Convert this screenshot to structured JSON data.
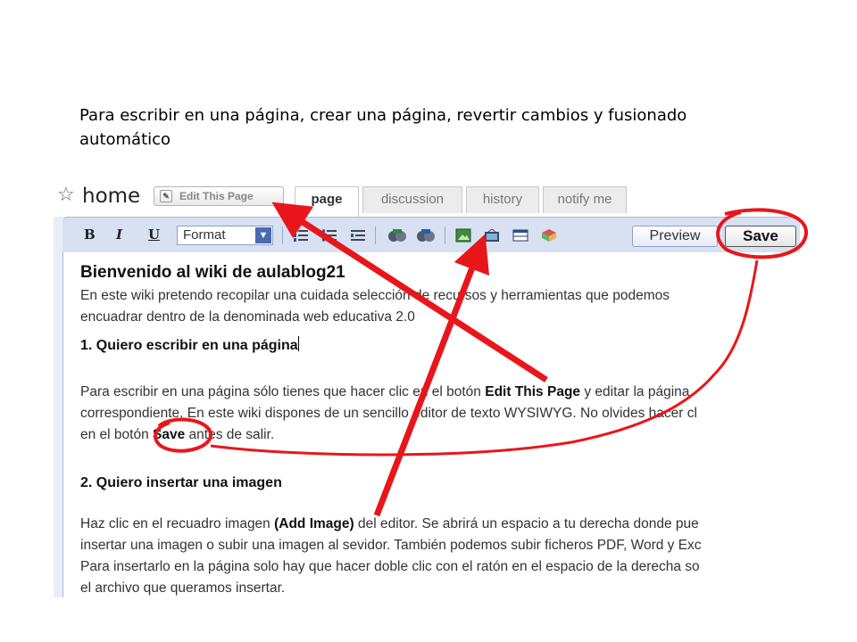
{
  "slide": {
    "caption": "Para escribir en una página, crear una página,  revertir cambios  y fusionado automático"
  },
  "wiki": {
    "page_name": "home",
    "edit_button": "Edit This Page",
    "tabs": [
      {
        "label": "page",
        "active": true
      },
      {
        "label": "discussion",
        "active": false
      },
      {
        "label": "history",
        "active": false
      },
      {
        "label": "notify me",
        "active": false
      }
    ],
    "toolbar": {
      "bold": "B",
      "italic": "I",
      "underline": "U",
      "format_value": "Format",
      "icons": [
        "numbered-list-icon",
        "bullet-list-icon",
        "indent-icon",
        "link-icon",
        "external-link-icon",
        "image-icon",
        "video-icon",
        "table-icon",
        "widget-icon"
      ],
      "preview": "Preview",
      "save": "Save"
    },
    "content": {
      "title": "Bienvenido al wiki de aulablog21",
      "intro_line1": "En este wiki pretendo recopilar una cuidada selección de recursos y herramientas que podemos",
      "intro_line2": "encuadrar dentro de la denominada web educativa 2.0",
      "h1": "1. Quiero escribir en una página",
      "p1_l1_a": "Para escribir en una página sólo tienes que hacer clic en el botón ",
      "p1_l1_b": "Edit This Page",
      "p1_l1_c": " y editar la página",
      "p1_l2": "correspondiente. En este wiki dispones de un sencillo editor de texto WYSIWYG. No olvides hacer cl",
      "p1_l3_a": "en el botón ",
      "p1_l3_b": "Save",
      "p1_l3_c": " antes de salir.",
      "h2": "2. Quiero insertar una imagen",
      "p2_l1_a": "Haz clic en el recuadro imagen ",
      "p2_l1_b": "(Add Image)",
      "p2_l1_c": " del editor. Se abrirá un espacio a tu derecha donde pue",
      "p2_l2": "insertar una imagen o subir una imagen al sevidor. También podemos subir ficheros PDF, Word y Exc",
      "p2_l3": "Para insertarlo en la página solo hay que hacer doble clic con el ratón en el espacio de la derecha so",
      "p2_l4": "el archivo que queramos insertar."
    }
  },
  "annotation_color": "#e8161b"
}
